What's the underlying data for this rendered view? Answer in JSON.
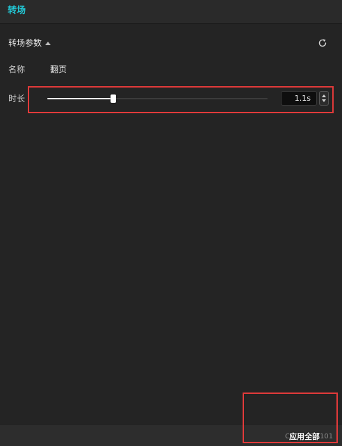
{
  "tabs": {
    "active_label": "转场"
  },
  "section": {
    "title": "转场参数",
    "reset_icon": "refresh-icon"
  },
  "fields": {
    "name_label": "名称",
    "name_value": "翻页",
    "duration_label": "时长",
    "duration_value": "1.1s",
    "duration_slider_fraction": 0.3
  },
  "footer": {
    "watermark": "CSDN @jc101",
    "apply_all_label": "应用全部"
  },
  "colors": {
    "accent": "#22c8d6",
    "highlight": "#e23a3a",
    "background": "#242424"
  }
}
